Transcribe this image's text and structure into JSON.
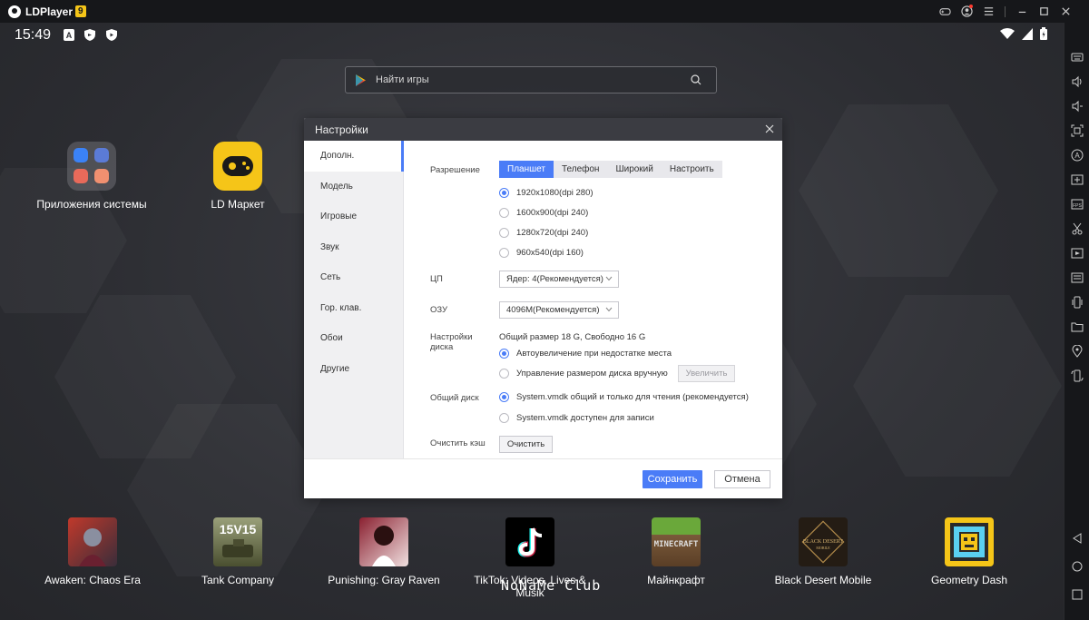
{
  "titlebar": {
    "app_name": "LDPlayer",
    "version_badge": "9",
    "icons": [
      "gamepad-icon",
      "account-icon",
      "menu-icon",
      "minimize-icon",
      "maximize-icon",
      "close-icon"
    ]
  },
  "statusbar": {
    "time": "15:49",
    "left_icons": [
      "notification-a-icon",
      "shield-icon",
      "play-protect-icon"
    ],
    "right_icons": [
      "wifi-icon",
      "signal-icon",
      "battery-icon"
    ]
  },
  "search": {
    "placeholder": "Найти игры"
  },
  "desktop_apps": [
    {
      "label": "Приложения системы"
    },
    {
      "label": "LD Маркет"
    }
  ],
  "dock_apps": [
    {
      "label": "Awaken: Chaos Era",
      "color": "#8a1c22"
    },
    {
      "label": "Tank Company",
      "color": "#5a5f3a"
    },
    {
      "label": "Punishing: Gray Raven",
      "color": "#5a1a22"
    },
    {
      "label": "TikTok: Videos, Lives & Musik",
      "color": "#000000"
    },
    {
      "label": "Майнкрафт",
      "color": "#5c8a2c"
    },
    {
      "label": "Black Desert Mobile",
      "color": "#2a2218"
    },
    {
      "label": "Geometry Dash",
      "color": "#f5c518"
    }
  ],
  "watermark": "NoNaMe Club",
  "sidebar_icons": [
    "keyboard-icon",
    "volume-up-icon",
    "volume-down-icon",
    "fullscreen-icon",
    "macro-icon",
    "add-screen-icon",
    "fps-icon",
    "scissors-icon",
    "record-icon",
    "apk-icon",
    "shake-icon",
    "folder-icon",
    "location-icon",
    "rotate-icon",
    "back-icon",
    "home-icon",
    "recent-icon"
  ],
  "dialog": {
    "title": "Настройки",
    "tabs": [
      "Дополн.",
      "Модель",
      "Игровые",
      "Звук",
      "Сеть",
      "Гор. клав.",
      "Обои",
      "Другие"
    ],
    "active_tab": "Дополн.",
    "resolution": {
      "label": "Разрешение",
      "modes": [
        "Планшет",
        "Телефон",
        "Широкий",
        "Настроить"
      ],
      "active_mode": "Планшет",
      "options": [
        "1920x1080(dpi 280)",
        "1600x900(dpi 240)",
        "1280x720(dpi 240)",
        "960x540(dpi 160)"
      ],
      "selected": "1920x1080(dpi 280)"
    },
    "cpu": {
      "label": "ЦП",
      "value": "Ядер: 4(Рекомендуется)"
    },
    "ram": {
      "label": "ОЗУ",
      "value": "4096M(Рекомендуется)"
    },
    "disk": {
      "label": "Настройки диска",
      "summary": "Общий размер 18 G, Свободно 16 G",
      "options": [
        "Автоувеличение при недостатке места",
        "Управление размером диска вручную"
      ],
      "selected": "Автоувеличение при недостатке места",
      "expand_button": "Увеличить"
    },
    "shared_disk": {
      "label": "Общий диск",
      "options": [
        "System.vmdk общий и только для чтения (рекомендуется)",
        "System.vmdk доступен для записи"
      ],
      "selected": "System.vmdk общий и только для чтения (рекомендуется)"
    },
    "cache": {
      "label": "Очистить кэш",
      "button": "Очистить"
    },
    "save_button": "Сохранить",
    "cancel_button": "Отмена",
    "accent_color": "#4a7cf7"
  }
}
